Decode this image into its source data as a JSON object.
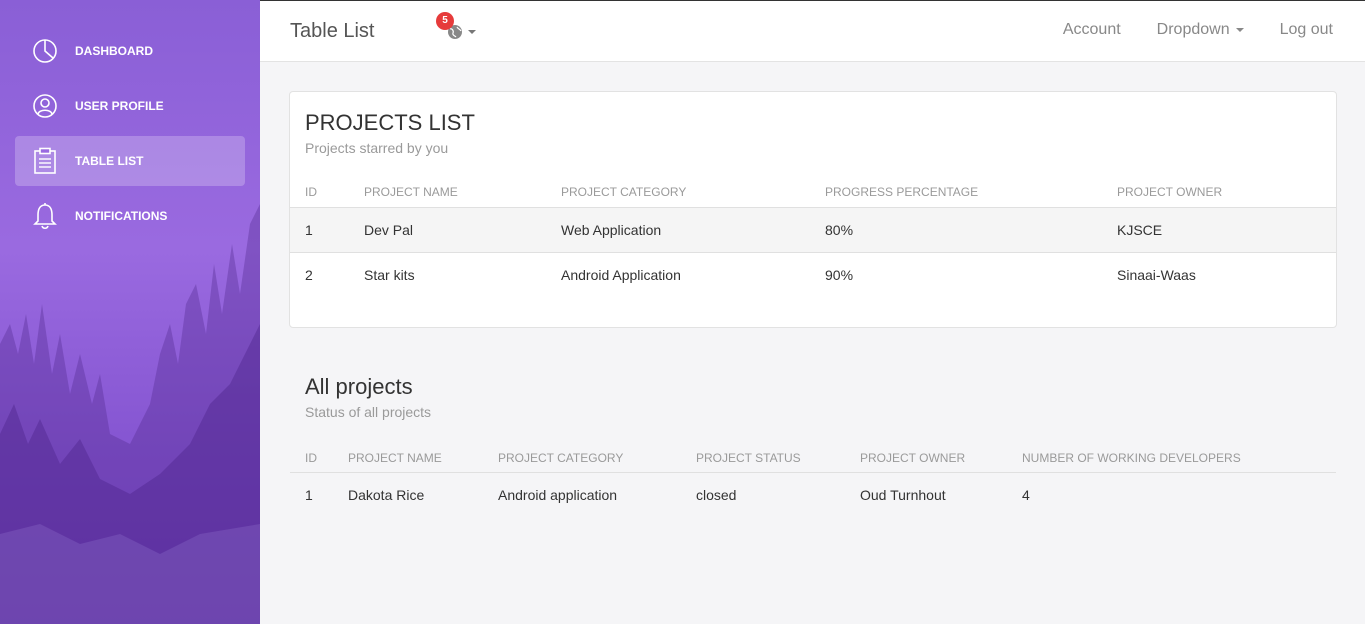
{
  "sidebar": {
    "items": [
      {
        "label": "DASHBOARD",
        "icon": "pie-chart-icon",
        "active": false
      },
      {
        "label": "USER PROFILE",
        "icon": "user-icon",
        "active": false
      },
      {
        "label": "TABLE LIST",
        "icon": "clipboard-icon",
        "active": true
      },
      {
        "label": "NOTIFICATIONS",
        "icon": "bell-icon",
        "active": false
      }
    ],
    "gradient_colors": [
      "#8a5fd6",
      "#7a48c6"
    ]
  },
  "topbar": {
    "title": "Table List",
    "notification_count": "5",
    "notification_icon": "globe-icon",
    "links": {
      "account": "Account",
      "dropdown": "Dropdown",
      "logout": "Log out"
    }
  },
  "projects_list": {
    "title": "PROJECTS LIST",
    "subtitle": "Projects starred by you",
    "columns": [
      "ID",
      "PROJECT NAME",
      "PROJECT CATEGORY",
      "PROGRESS PERCENTAGE",
      "PROJECT OWNER"
    ],
    "rows": [
      [
        "1",
        "Dev Pal",
        "Web Application",
        "80%",
        "KJSCE"
      ],
      [
        "2",
        "Star kits",
        "Android Application",
        "90%",
        "Sinaai-Waas"
      ]
    ]
  },
  "all_projects": {
    "title": "All projects",
    "subtitle": "Status of all projects",
    "columns": [
      "ID",
      "PROJECT NAME",
      "PROJECT CATEGORY",
      "PROJECT STATUS",
      "PROJECT OWNER",
      "NUMBER OF WORKING DEVELOPERS"
    ],
    "rows": [
      [
        "1",
        "Dakota Rice",
        "Android application",
        "closed",
        "Oud Turnhout",
        "4"
      ]
    ]
  },
  "colors": {
    "badge": "#e63b3b",
    "active_nav_bg": "rgba(255,255,255,0.23)"
  }
}
